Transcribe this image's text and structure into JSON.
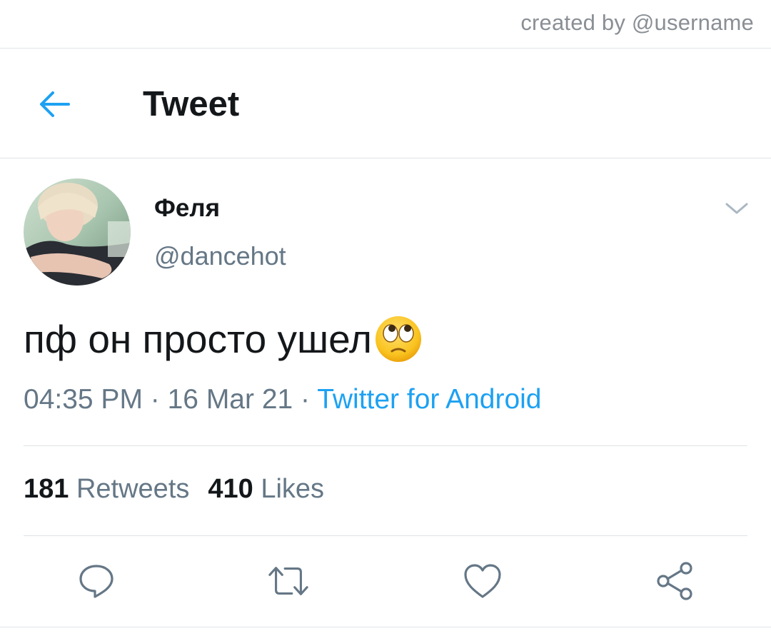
{
  "watermark": {
    "text": "created by @username"
  },
  "header": {
    "title": "Tweet",
    "back_icon": "arrow-left-icon"
  },
  "tweet": {
    "author_name": "Феля",
    "author_handle": "@dancehot",
    "text": "пф он просто ушел",
    "emoji": "face-with-rolling-eyes",
    "time": "04:35 PM",
    "date": "16 Mar 21",
    "separator": " · ",
    "source": "Twitter for Android",
    "retweets_count": "181",
    "retweets_label": "Retweets",
    "likes_count": "410",
    "likes_label": "Likes"
  },
  "actions": [
    "reply-icon",
    "retweet-icon",
    "like-icon",
    "share-icon"
  ],
  "colors": {
    "accent": "#1da1f2",
    "secondary_text": "#657786",
    "primary_text": "#14171a",
    "divider": "#dfe3e6"
  }
}
